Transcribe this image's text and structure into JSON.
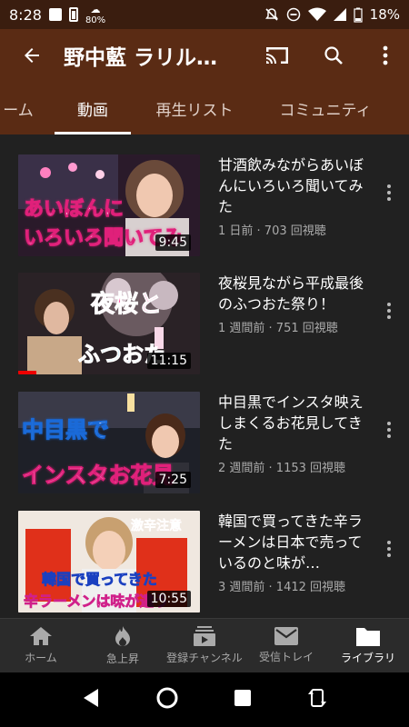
{
  "status": {
    "time": "8:28",
    "battery_text": "80%",
    "battery_percent": "18%"
  },
  "appbar": {
    "title": "野中藍 ラリル…"
  },
  "tabs": [
    {
      "label": "ーム"
    },
    {
      "label": "動画"
    },
    {
      "label": "再生リスト"
    },
    {
      "label": "コミュニティ"
    }
  ],
  "videos": [
    {
      "title": "甘酒飲みながらあいぼんにいろいろ聞いてみた",
      "info": "1 日前 · 703 回視聴",
      "duration": "9:45",
      "caption1": "あいぼんに",
      "caption2": "いろいろ聞いてみ"
    },
    {
      "title": "夜桜見ながら平成最後のふつおた祭り！",
      "info": "1 週間前 · 751 回視聴",
      "duration": "11:15",
      "caption1": "夜桜と",
      "caption2": "ふつおた"
    },
    {
      "title": "中目黒でインスタ映えしまくるお花見してきた",
      "info": "2 週間前 · 1153 回視聴",
      "duration": "7:25",
      "caption1": "中目黒で",
      "caption2": "インスタお花見"
    },
    {
      "title": "韓国で買ってきた辛ラーメンは日本で売っているのと味が…",
      "info": "3 週間前 · 1412 回視聴",
      "duration": "10:55",
      "caption1": "激辛注意",
      "caption2": "韓国で買ってきた",
      "caption3": "辛ラーメンは味が違う"
    }
  ],
  "bottomnav": [
    {
      "label": "ホーム",
      "icon": "home-icon"
    },
    {
      "label": "急上昇",
      "icon": "flame-icon"
    },
    {
      "label": "登録チャンネル",
      "icon": "subscriptions-icon"
    },
    {
      "label": "受信トレイ",
      "icon": "inbox-icon"
    },
    {
      "label": "ライブラリ",
      "icon": "library-icon"
    }
  ]
}
